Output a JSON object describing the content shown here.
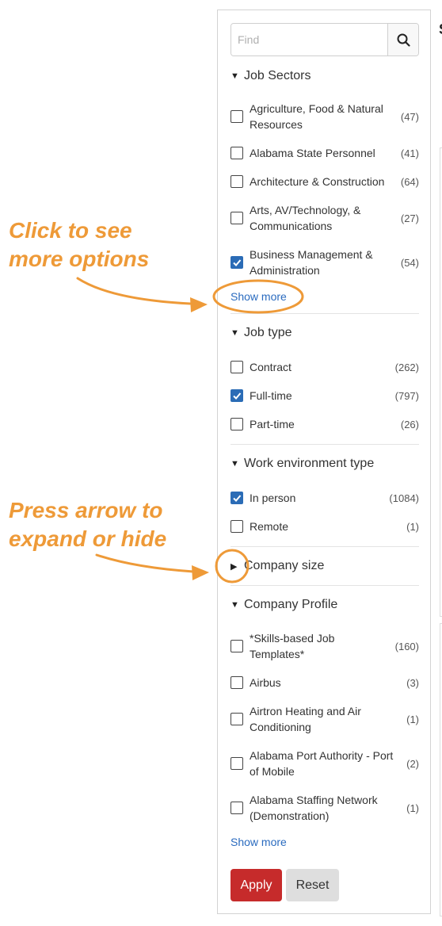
{
  "search": {
    "placeholder": "Find",
    "icon": "search-icon"
  },
  "sections": {
    "job_sectors": {
      "title": "Job Sectors",
      "expanded": true,
      "items": [
        {
          "label": "Agriculture, Food & Natural Resources",
          "count": "(47)",
          "checked": false
        },
        {
          "label": "Alabama State Personnel",
          "count": "(41)",
          "checked": false
        },
        {
          "label": "Architecture & Construction",
          "count": "(64)",
          "checked": false
        },
        {
          "label": "Arts, AV/Technology, & Communications",
          "count": "(27)",
          "checked": false
        },
        {
          "label": "Business Management & Administration",
          "count": "(54)",
          "checked": true
        }
      ],
      "show_more": "Show more"
    },
    "job_type": {
      "title": "Job type",
      "expanded": true,
      "items": [
        {
          "label": "Contract",
          "count": "(262)",
          "checked": false
        },
        {
          "label": "Full-time",
          "count": "(797)",
          "checked": true
        },
        {
          "label": "Part-time",
          "count": "(26)",
          "checked": false
        }
      ]
    },
    "work_environment": {
      "title": "Work environment type",
      "expanded": true,
      "items": [
        {
          "label": "In person",
          "count": "(1084)",
          "checked": true
        },
        {
          "label": "Remote",
          "count": "(1)",
          "checked": false
        }
      ]
    },
    "company_size": {
      "title": "Company size",
      "expanded": false
    },
    "company_profile": {
      "title": "Company Profile",
      "expanded": true,
      "items": [
        {
          "label": "*Skills-based Job Templates*",
          "count": "(160)",
          "checked": false
        },
        {
          "label": "Airbus",
          "count": "(3)",
          "checked": false
        },
        {
          "label": "Airtron Heating and Air Conditioning",
          "count": "(1)",
          "checked": false
        },
        {
          "label": "Alabama Port Authority - Port of Mobile",
          "count": "(2)",
          "checked": false
        },
        {
          "label": "Alabama Staffing Network (Demonstration)",
          "count": "(1)",
          "checked": false
        }
      ],
      "show_more": "Show more"
    }
  },
  "actions": {
    "apply": "Apply",
    "reset": "Reset"
  },
  "annotations": {
    "show_more_line1": "Click to see",
    "show_more_line2": "more options",
    "arrow_line1": "Press arrow to",
    "arrow_line2": "expand or hide"
  },
  "colors": {
    "annotation": "#ee9a38",
    "checkbox_checked": "#2b6cb6",
    "link": "#2a6bbf",
    "apply_button": "#c62b2b",
    "reset_button": "#dedede"
  },
  "edge_text": "S"
}
